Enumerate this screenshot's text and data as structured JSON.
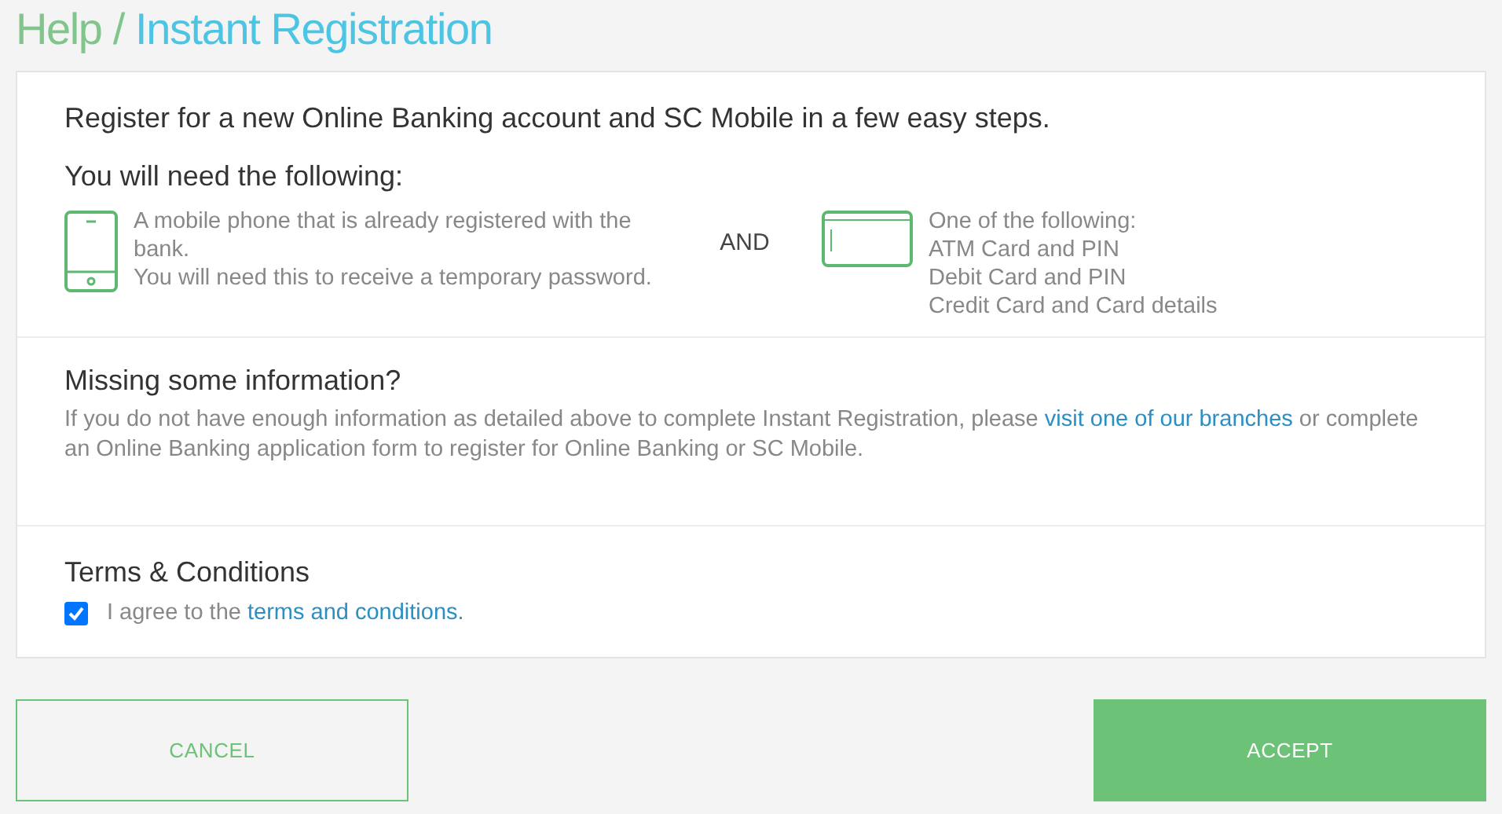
{
  "breadcrumb": {
    "parent": "Help / ",
    "current": "Instant Registration"
  },
  "intro": "Register for a new Online Banking account and SC Mobile in a few easy steps.",
  "requirements": {
    "heading": "You will need the following:",
    "items": [
      {
        "kind": "phone",
        "lines": [
          "A mobile phone that is already registered with the bank.",
          "You will need this to receive a temporary password."
        ]
      },
      {
        "kind": "card",
        "lines": [
          "One of the following:",
          "ATM Card and PIN",
          "Debit Card and PIN",
          "Credit Card and Card details"
        ]
      }
    ],
    "joiner": "AND"
  },
  "missing": {
    "heading": "Missing some information?",
    "text_before": "If you do not have enough information as detailed above to complete Instant Registration, please ",
    "link": "visit one of our branches",
    "text_after": " or complete an Online Banking application form to register for Online Banking or SC Mobile."
  },
  "terms": {
    "heading": "Terms & Conditions",
    "checked": true,
    "text": "I agree to the ",
    "link": "terms and conditions."
  },
  "buttons": [
    {
      "kind": "secondary",
      "label": "CANCEL"
    },
    {
      "kind": "primary",
      "label": "ACCEPT"
    }
  ]
}
